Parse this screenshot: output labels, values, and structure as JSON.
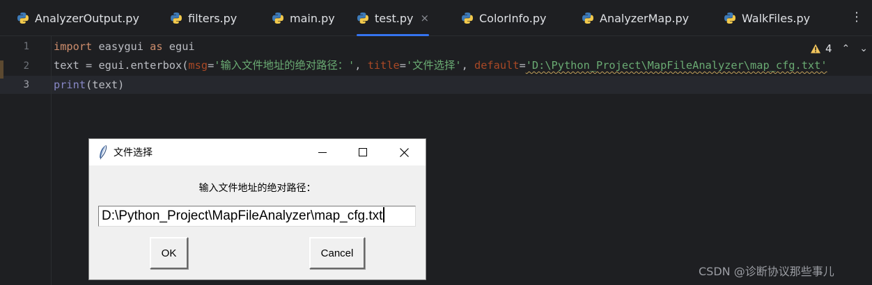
{
  "tabs": [
    {
      "label": "AnalyzerOutput.py",
      "active": false
    },
    {
      "label": "filters.py",
      "active": false
    },
    {
      "label": "main.py",
      "active": false
    },
    {
      "label": "test.py",
      "active": true,
      "close": "×"
    },
    {
      "label": "ColorInfo.py",
      "active": false
    },
    {
      "label": "AnalyzerMap.py",
      "active": false
    },
    {
      "label": "WalkFiles.py",
      "active": false
    }
  ],
  "tab_menu_glyph": "⋮",
  "editor": {
    "line_numbers": [
      "1",
      "2",
      "3"
    ],
    "line1": {
      "kw1": "import",
      "mod": " easygui ",
      "kw2": "as",
      "alias": " egui"
    },
    "line2": {
      "lhs": "text = egui.",
      "fn": "enterbox",
      "p_open": "(",
      "p1": "msg",
      "eq1": "=",
      "s1": "'输入文件地址的绝对路径：'",
      "sep1": ", ",
      "p2": "title",
      "eq2": "=",
      "s2": "'文件选择'",
      "sep2": ", ",
      "p3": "default",
      "eq3": "=",
      "s3": "'D:\\Python_Project\\MapFileAnalyzer\\map_cfg.txt'"
    },
    "line3": {
      "fn": "print",
      "args": "(text)"
    },
    "inspection": {
      "count": "4",
      "icon": "warning-triangle",
      "up": "⌃",
      "down": "⌄"
    }
  },
  "dialog": {
    "title": "文件选择",
    "prompt": "输入文件地址的绝对路径：",
    "entry_value": "D:\\Python_Project\\MapFileAnalyzer\\map_cfg.txt",
    "ok_label": "OK",
    "cancel_label": "Cancel"
  },
  "watermark": "CSDN @诊断协议那些事儿",
  "colors": {
    "editor_bg": "#1e1f22",
    "keyword": "#cf8e6d",
    "string": "#6aab73",
    "param": "#aa4926",
    "function": "#56a8f5",
    "builtin": "#8888c6",
    "accent": "#3574f0"
  }
}
